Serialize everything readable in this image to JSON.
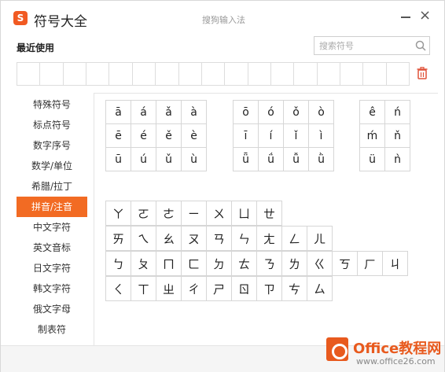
{
  "app": {
    "logo_letter": "S",
    "title": "符号大全",
    "ime_title": "搜狗输入法"
  },
  "window_controls": {
    "minimize": "minimize-icon",
    "close": "×"
  },
  "recent": {
    "label": "最近使用",
    "cells": 17
  },
  "search": {
    "placeholder": "搜索符号",
    "value": ""
  },
  "sidebar": {
    "items": [
      {
        "label": "特殊符号"
      },
      {
        "label": "标点符号"
      },
      {
        "label": "数字序号"
      },
      {
        "label": "数学/单位"
      },
      {
        "label": "希腊/拉丁"
      },
      {
        "label": "拼音/注音",
        "active": true
      },
      {
        "label": "中文字符"
      },
      {
        "label": "英文音标"
      },
      {
        "label": "日文字符"
      },
      {
        "label": "韩文字符"
      },
      {
        "label": "俄文字母"
      },
      {
        "label": "制表符"
      }
    ]
  },
  "pinyin": {
    "group_a": [
      "ā",
      "á",
      "ǎ",
      "à",
      "ē",
      "é",
      "ě",
      "è",
      "ū",
      "ú",
      "ǔ",
      "ù"
    ],
    "group_o": [
      "ō",
      "ó",
      "ǒ",
      "ò",
      "ī",
      "í",
      "ǐ",
      "ì",
      "ǖ",
      "ǘ",
      "ǚ",
      "ǜ"
    ],
    "group_e": [
      "ê",
      "ń",
      "ḿ",
      "ň",
      "ü",
      "ǹ"
    ]
  },
  "zhuyin": {
    "row1": [
      "ㄚ",
      "ㄛ",
      "ㄜ",
      "ㄧ",
      "ㄨ",
      "ㄩ",
      "ㄝ"
    ],
    "row2": [
      "ㄞ",
      "ㄟ",
      "ㄠ",
      "ㄡ",
      "ㄢ",
      "ㄣ",
      "ㄤ",
      "ㄥ",
      "ㄦ"
    ],
    "row3": [
      "ㄅ",
      "ㄆ",
      "ㄇ",
      "ㄈ",
      "ㄉ",
      "ㄊ",
      "ㄋ",
      "ㄌ",
      "ㄍ",
      "ㄎ",
      "ㄏ",
      "ㄐ"
    ],
    "row4": [
      "ㄑ",
      "ㄒ",
      "ㄓ",
      "ㄔ",
      "ㄕ",
      "ㄖ",
      "ㄗ",
      "ㄘ",
      "ㄙ"
    ]
  },
  "watermark": {
    "brand": "Office教程网",
    "url": "www.office26.com"
  },
  "colors": {
    "accent": "#f26b23",
    "logo": "#f15a22",
    "trash": "#e0533a"
  }
}
